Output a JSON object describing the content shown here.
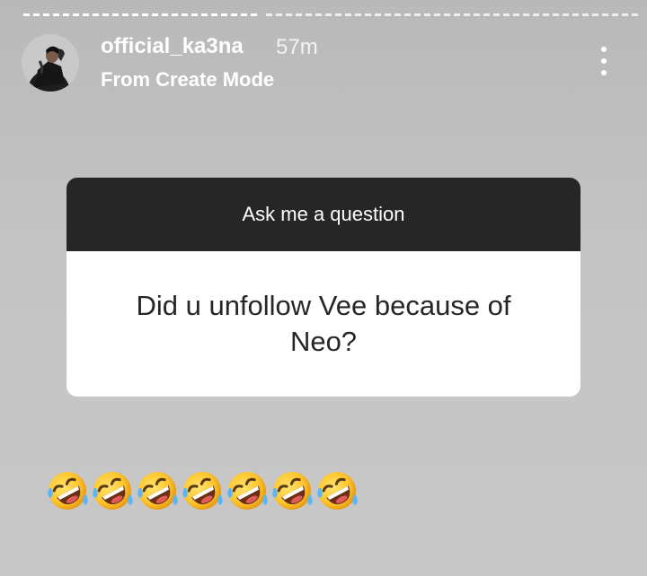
{
  "story": {
    "progress_segments": 2,
    "current_segment": 1
  },
  "header": {
    "username": "official_ka3na",
    "time_ago": "57m",
    "subtitle": "From Create Mode",
    "more_icon": "more-vertical-icon"
  },
  "question_card": {
    "header": "Ask me a question",
    "question": "Did u unfollow Vee because of Neo?"
  },
  "emojis": {
    "icon": "rolling-on-the-floor-laughing-emoji",
    "count": 7
  },
  "colors": {
    "background": "#c4c4c4",
    "card_header": "#262626",
    "card_body": "#ffffff",
    "text_dark": "#262626",
    "text_light": "#ffffff"
  }
}
